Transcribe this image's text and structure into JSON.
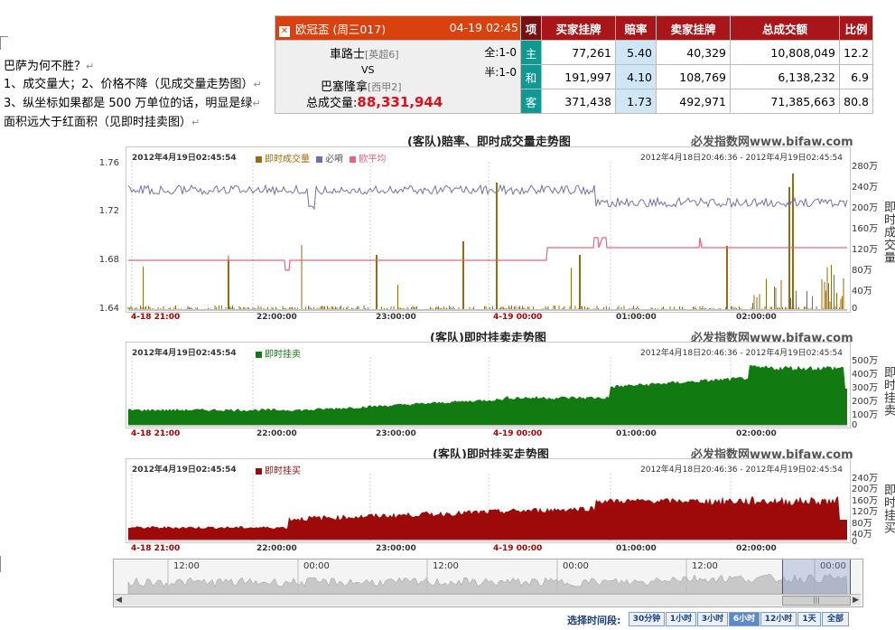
{
  "notes": {
    "line1": "巴萨为何不胜？",
    "line2": "1、成交量大；2、价格不降（见成交量走势图）",
    "line3": "3、纵坐标如果都是 500 万单位的话，明显是绿",
    "line4": "面积远大于红面积（见即时挂卖图）",
    "return_mark": "↵"
  },
  "match": {
    "competition": "欧冠盃 (周三017)",
    "datetime": "04-19 02:45",
    "home": "車路士",
    "home_league": "[英超6]",
    "vs": "VS",
    "away": "巴塞隆拿",
    "away_league": "[西甲2]",
    "full_label": "全:1-0",
    "half_label": "半:1-0",
    "total_volume_label": "总成交量:",
    "total_volume": "88,331,944"
  },
  "table": {
    "headers": [
      "项",
      "买家挂牌",
      "賠率",
      "卖家挂牌",
      "总成交额",
      "比例"
    ],
    "rows": [
      {
        "type": "主",
        "buy": "77,261",
        "odds": "5.40",
        "sell": "40,329",
        "total": "10,808,049",
        "ratio": "12.2"
      },
      {
        "type": "和",
        "buy": "191,997",
        "odds": "4.10",
        "sell": "108,769",
        "total": "6,138,232",
        "ratio": "6.9"
      },
      {
        "type": "客",
        "buy": "371,438",
        "odds": "1.73",
        "sell": "492,971",
        "total": "71,385,663",
        "ratio": "80.8"
      }
    ]
  },
  "brand": "必发指数网www.bifaw.com",
  "chart1": {
    "title": "(客队)賠率、即时成交量走势图",
    "date": "2012年4月19日02:45:54",
    "legend": [
      "即时成交量",
      "必嗬",
      "欧平均"
    ],
    "range": "2012年4月18日20:46:36 - 2012年4月19日02:45:54",
    "yleft": [
      "1.76",
      "1.72",
      "1.68",
      "1.64"
    ],
    "yright": [
      "280万",
      "240万",
      "200万",
      "160万",
      "120万",
      "80万",
      "40万",
      "0"
    ],
    "ylabel": "即时成交量"
  },
  "chart2": {
    "title": "(客队)即时挂卖走势图",
    "date": "2012年4月19日02:45:54",
    "legend": "即时挂卖",
    "range": "2012年4月18日20:46:36 - 2012年4月19日02:45:54",
    "yright": [
      "500万",
      "400万",
      "300万",
      "200万",
      "100万",
      "0"
    ],
    "ylabel": "即时挂卖"
  },
  "chart3": {
    "title": "(客队)即时挂买走势图",
    "date": "2012年4月19日02:45:54",
    "legend": "即时挂买",
    "range": "2012年4月18日20:46:36 - 2012年4月19日02:45:54",
    "yright": [
      "240万",
      "200万",
      "160万",
      "120万",
      "80万",
      "40万",
      "0"
    ],
    "ylabel": "即时挂买"
  },
  "xticks": [
    "4-18 21:00",
    "22:00:00",
    "23:00:00",
    "4-19 00:00",
    "01:00:00",
    "02:00:00"
  ],
  "navigator": {
    "ticks": [
      "12:00",
      "00:00",
      "12:00",
      "00:00",
      "12:00",
      "00:00"
    ]
  },
  "range_selector": {
    "label": "选择时间段:",
    "options": [
      "30分钟",
      "1小时",
      "3小时",
      "6小时",
      "12小时",
      "1天",
      "全部"
    ],
    "selected": "6小时"
  },
  "colors": {
    "volume": "#9a6b0a",
    "bifa": "#7070b0",
    "euro_avg": "#f06080",
    "sell": "#117a11",
    "buy": "#9e0a0a",
    "header_red": "#a8161a",
    "teal": "#0e9a93"
  }
}
